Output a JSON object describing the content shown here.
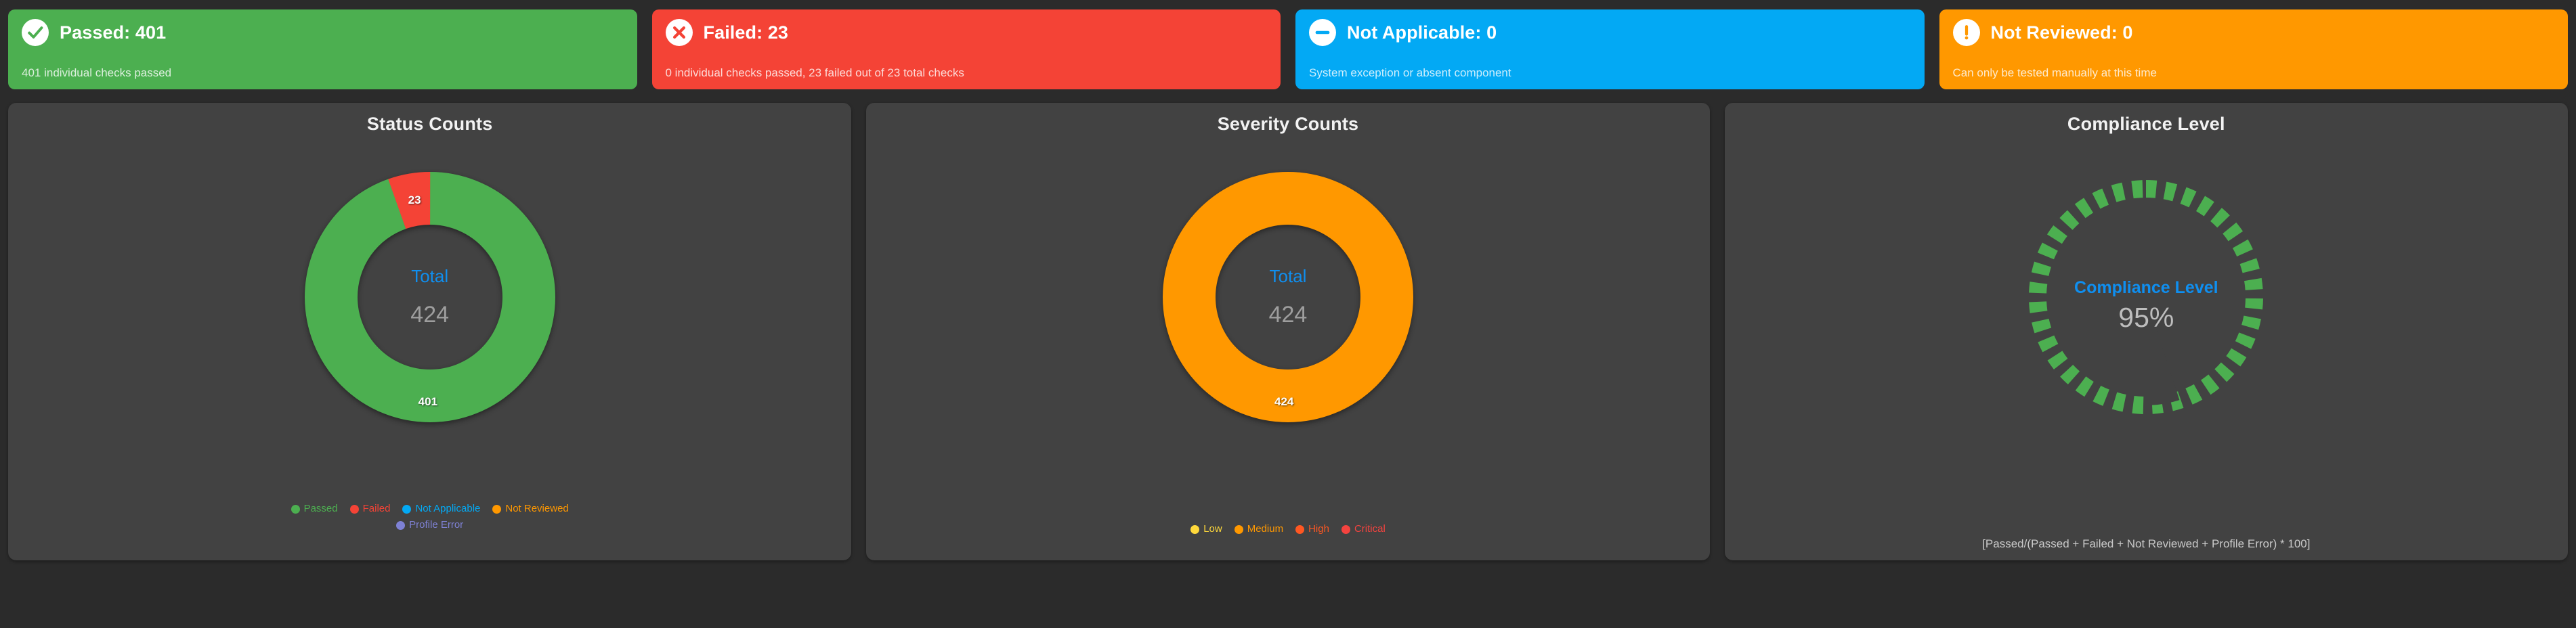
{
  "theme": {
    "page_bg": "#2b2b2b",
    "panel_bg": "#424242",
    "accent_blue": "#0f8ff0",
    "value_gray": "#9e9e9e"
  },
  "status_cards": [
    {
      "id": "passed",
      "icon": "check-circle-icon",
      "title": "Passed: 401",
      "subtitle": "401 individual checks passed",
      "color": "#4caf50"
    },
    {
      "id": "failed",
      "icon": "x-circle-icon",
      "title": "Failed: 23",
      "subtitle": "0 individual checks passed, 23 failed out of 23 total checks",
      "color": "#f44336"
    },
    {
      "id": "not-applicable",
      "icon": "minus-circle-icon",
      "title": "Not Applicable: 0",
      "subtitle": "System exception or absent component",
      "color": "#03a9f4"
    },
    {
      "id": "not-reviewed",
      "icon": "exclamation-circle-icon",
      "title": "Not Reviewed: 0",
      "subtitle": "Can only be tested manually at this time",
      "color": "#ff9800"
    }
  ],
  "panels": {
    "status": {
      "title": "Status Counts",
      "center_label": "Total",
      "center_value": "424",
      "slice_labels": {
        "failed": "23",
        "passed": "401"
      }
    },
    "severity": {
      "title": "Severity Counts",
      "center_label": "Total",
      "center_value": "424",
      "slice_labels": {
        "medium": "424"
      }
    },
    "compliance": {
      "title": "Compliance Level",
      "center_label": "Compliance Level",
      "center_value": "95%",
      "footnote": "[Passed/(Passed + Failed + Not Reviewed + Profile Error) * 100]"
    }
  },
  "chart_data": [
    {
      "id": "status-counts",
      "type": "pie",
      "title": "Status Counts",
      "donut": true,
      "total_label": "Total",
      "total": 424,
      "categories": [
        "Passed",
        "Failed",
        "Not Applicable",
        "Not Reviewed",
        "Profile Error"
      ],
      "values": [
        401,
        23,
        0,
        0,
        0
      ],
      "colors": [
        "#4caf50",
        "#f44336",
        "#03a9f4",
        "#ff9800",
        "#7e81d4"
      ],
      "visible_slice_labels": [
        "401",
        "23"
      ],
      "legend_position": "bottom",
      "legend": [
        {
          "label": "Passed",
          "color": "#4caf50"
        },
        {
          "label": "Failed",
          "color": "#f44336"
        },
        {
          "label": "Not Applicable",
          "color": "#03a9f4"
        },
        {
          "label": "Not Reviewed",
          "color": "#ff9800"
        },
        {
          "label": "Profile Error",
          "color": "#7e81d4"
        }
      ]
    },
    {
      "id": "severity-counts",
      "type": "pie",
      "title": "Severity Counts",
      "donut": true,
      "total_label": "Total",
      "total": 424,
      "categories": [
        "Low",
        "Medium",
        "High",
        "Critical"
      ],
      "values": [
        0,
        424,
        0,
        0
      ],
      "colors": [
        "#ffd93b",
        "#ff9800",
        "#ff5722",
        "#f4433f"
      ],
      "visible_slice_labels": [
        "424"
      ],
      "legend_position": "bottom",
      "legend": [
        {
          "label": "Low",
          "color": "#ffd93b"
        },
        {
          "label": "Medium",
          "color": "#ff9800"
        },
        {
          "label": "High",
          "color": "#ff5722"
        },
        {
          "label": "Critical",
          "color": "#f4433f"
        }
      ]
    },
    {
      "id": "compliance-level",
      "type": "pie",
      "title": "Compliance Level",
      "gauge": true,
      "center_label": "Compliance Level",
      "percent": 95,
      "ylim": [
        0,
        100
      ],
      "color": "#4caf50",
      "annotation": "[Passed/(Passed + Failed + Not Reviewed + Profile Error) * 100]"
    }
  ]
}
